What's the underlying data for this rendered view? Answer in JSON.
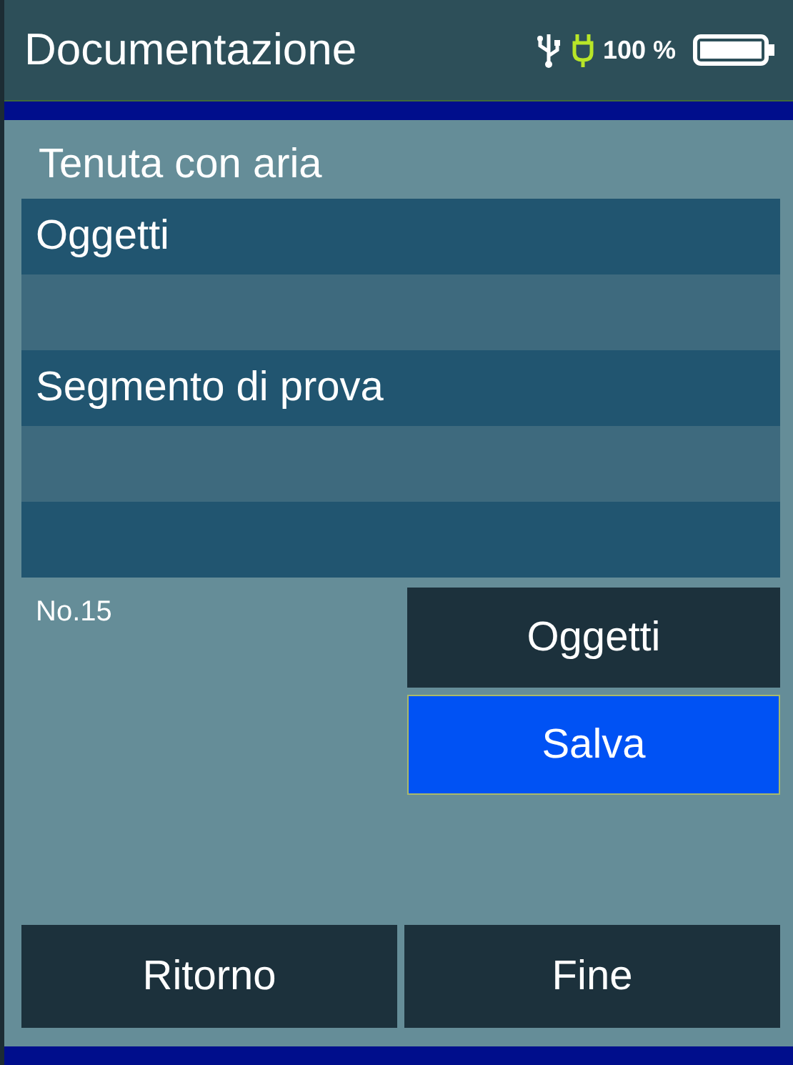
{
  "header": {
    "title": "Documentazione",
    "battery_text": "100 %"
  },
  "section_title": "Tenuta con aria",
  "list_rows": [
    {
      "kind": "entry",
      "label": "Oggetti"
    },
    {
      "kind": "blank"
    },
    {
      "kind": "entry",
      "label": "Segmento di prova"
    },
    {
      "kind": "blank"
    },
    {
      "kind": "blank"
    }
  ],
  "number_label": "No.15",
  "side_buttons": [
    {
      "label": "Oggetti",
      "selected": false
    },
    {
      "label": "Salva",
      "selected": true
    }
  ],
  "bottom_buttons": [
    {
      "label": "Ritorno",
      "selected": false
    },
    {
      "label": "Fine",
      "selected": false
    }
  ]
}
